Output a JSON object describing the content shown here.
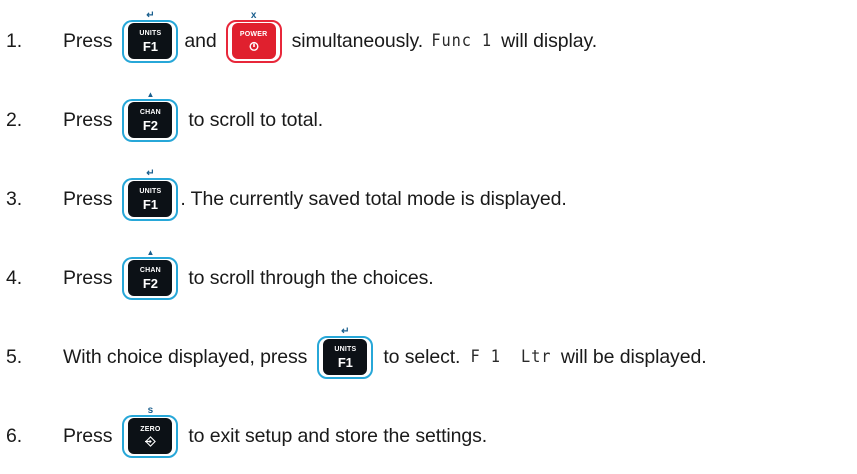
{
  "steps": [
    {
      "num": "1.",
      "parts": {
        "a": "Press",
        "b": "and",
        "c": "simultaneously.",
        "lcd": "Func 1",
        "d": "will display."
      }
    },
    {
      "num": "2.",
      "parts": {
        "a": "Press",
        "b": "to scroll to total."
      }
    },
    {
      "num": "3.",
      "parts": {
        "a": "Press",
        "b": ". The currently saved total mode is displayed."
      }
    },
    {
      "num": "4.",
      "parts": {
        "a": "Press",
        "b": "to scroll through the choices."
      }
    },
    {
      "num": "5.",
      "parts": {
        "a": "With choice displayed, press",
        "b": "to select.",
        "lcd": "F 1  Ltr",
        "c": "will be displayed."
      }
    },
    {
      "num": "6.",
      "parts": {
        "a": "Press",
        "b": "to exit setup and store the settings."
      }
    }
  ],
  "keys": {
    "units": {
      "top": "UNITS",
      "bottom": "F1",
      "above": "↵",
      "icon": "enter-arrow-icon"
    },
    "power": {
      "top": "POWER",
      "above": "x",
      "icon": "power-icon"
    },
    "chan": {
      "top": "CHAN",
      "bottom": "F2",
      "above": "▲",
      "icon": "up-triangle-icon"
    },
    "zero": {
      "top": "ZERO",
      "above": "s",
      "icon": "zero-arrow-icon"
    }
  },
  "colors": {
    "key_border": "#27a7d8",
    "power_border": "#e8273a",
    "key_face": "#0c1116",
    "power_face": "#e0202e"
  }
}
